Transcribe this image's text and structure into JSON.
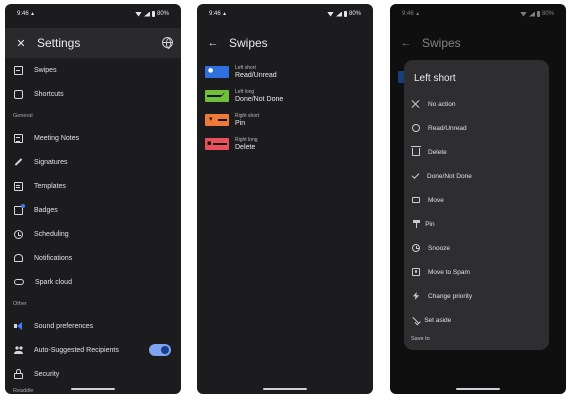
{
  "status": {
    "time": "9:46",
    "battery": "80%"
  },
  "settings": {
    "title": "Settings",
    "items_top": [
      {
        "label": "Swipes"
      },
      {
        "label": "Shortcuts"
      }
    ],
    "section_general": "General",
    "items_general": [
      {
        "label": "Meeting Notes"
      },
      {
        "label": "Signatures"
      },
      {
        "label": "Templates"
      },
      {
        "label": "Badges"
      },
      {
        "label": "Scheduling"
      },
      {
        "label": "Notifications"
      },
      {
        "label": "Spark cloud"
      }
    ],
    "section_other": "Other",
    "items_other": [
      {
        "label": "Sound preferences"
      },
      {
        "label": "Auto-Suggested Recipients",
        "toggle_on": true
      },
      {
        "label": "Security"
      }
    ],
    "section_peek": "Readdle"
  },
  "swipes": {
    "title": "Swipes",
    "rows": [
      {
        "kind": "Left short",
        "action": "Read/Unread",
        "color": "#2f6fe0"
      },
      {
        "kind": "Left long",
        "action": "Done/Not Done",
        "color": "#6fbf3a"
      },
      {
        "kind": "Right short",
        "action": "Pin",
        "color": "#f07a3a"
      },
      {
        "kind": "Right long",
        "action": "Delete",
        "color": "#e8505b"
      }
    ]
  },
  "dialog": {
    "title": "Left short",
    "options": [
      {
        "label": "No action",
        "icon": "close-icon"
      },
      {
        "label": "Read/Unread",
        "icon": "circle-icon"
      },
      {
        "label": "Delete",
        "icon": "trash-icon"
      },
      {
        "label": "Done/Not Done",
        "icon": "check-icon"
      },
      {
        "label": "Move",
        "icon": "folder-icon"
      },
      {
        "label": "Pin",
        "icon": "pin-icon"
      },
      {
        "label": "Snooze",
        "icon": "clock-icon"
      },
      {
        "label": "Move to Spam",
        "icon": "spam-icon"
      },
      {
        "label": "Change priority",
        "icon": "bolt-icon"
      },
      {
        "label": "Set aside",
        "icon": "set-aside-icon"
      }
    ],
    "save_label": "Save to",
    "behind_row_kind": "Left short"
  },
  "colors": {
    "accent": "#7ea4f0",
    "background": "#1c1c1e"
  }
}
